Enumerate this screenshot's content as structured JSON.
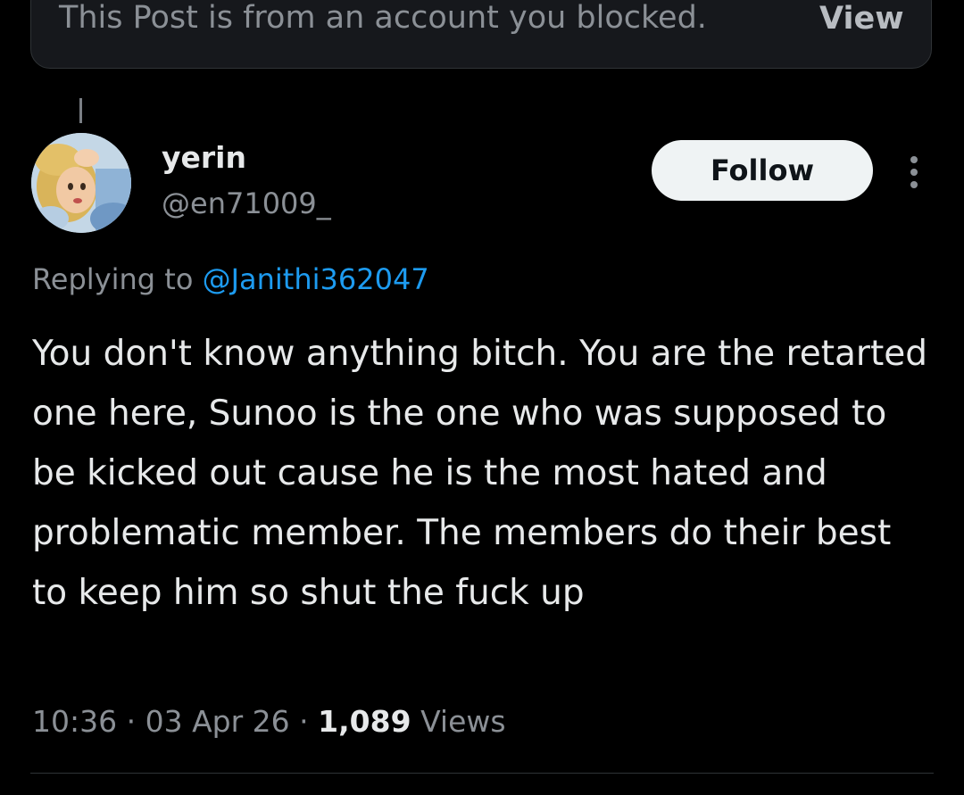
{
  "blocked_banner": {
    "message": "This Post is from an account you blocked.",
    "view_label": "View"
  },
  "author": {
    "display_name": "yerin",
    "handle": "@en71009_",
    "avatar_icon": "avatar-icon"
  },
  "follow_button": {
    "label": "Follow"
  },
  "reply": {
    "prefix": "Replying to",
    "to_handle": "@Janithi362047"
  },
  "tweet": {
    "text": "You don't know anything bitch. You are the retarted one here, Sunoo is the one who was supposed to be kicked out cause he is the most hated and problematic member. The members do their best to keep him so shut the fuck up"
  },
  "meta": {
    "time": "10:36",
    "date": "03 Apr 26",
    "separator": "·",
    "views_count": "1,089",
    "views_label": "Views"
  },
  "colors": {
    "background": "#000000",
    "text_primary": "#e7e9ea",
    "text_secondary": "#8b9096",
    "link": "#1d9bf0",
    "follow_bg": "#eff3f4"
  }
}
